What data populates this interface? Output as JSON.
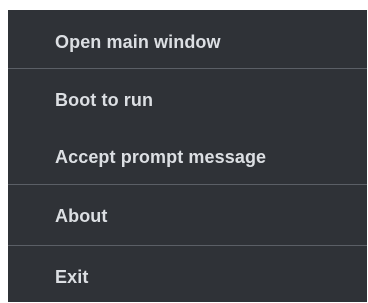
{
  "menu": {
    "items": [
      {
        "label": "Open main window"
      },
      {
        "label": "Boot to run"
      },
      {
        "label": "Accept prompt message"
      },
      {
        "label": "About"
      },
      {
        "label": "Exit"
      }
    ]
  },
  "colors": {
    "menu_background": "#2f3237",
    "menu_text": "#dcdfe3",
    "separator": "#5b5f66",
    "page_background": "#ffffff"
  }
}
